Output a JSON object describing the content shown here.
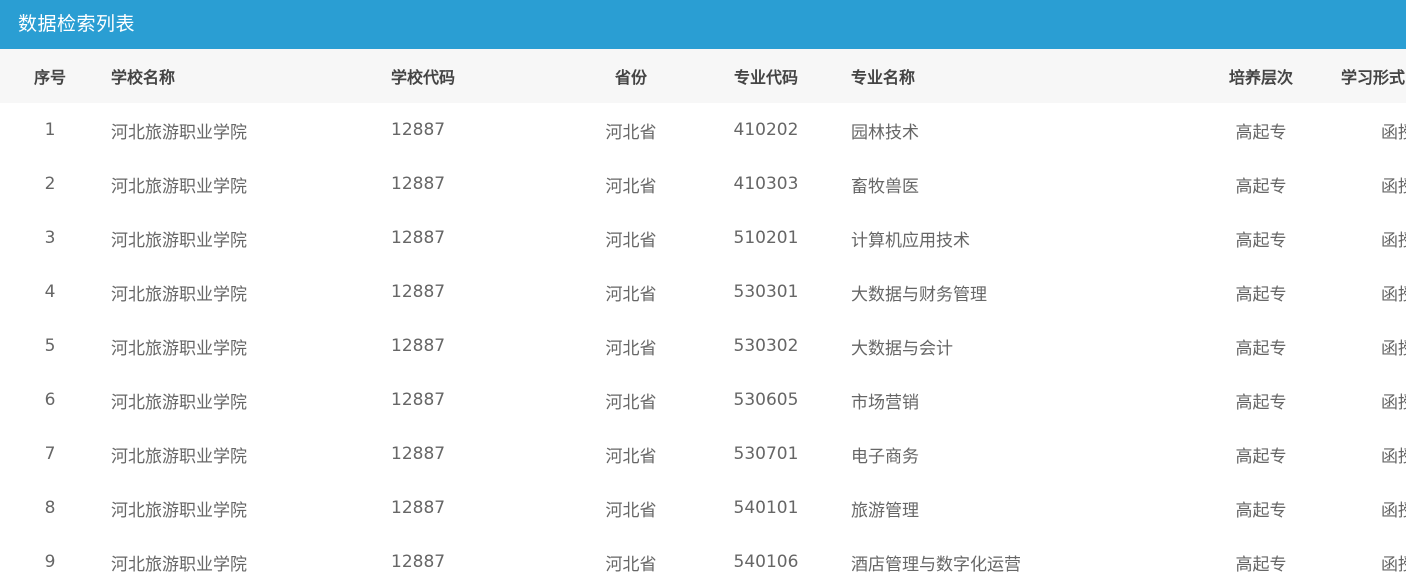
{
  "panel": {
    "title": "数据检索列表"
  },
  "columns": {
    "no": "序号",
    "school_name": "学校名称",
    "school_code": "学校代码",
    "province": "省份",
    "major_code": "专业代码",
    "major_name": "专业名称",
    "level": "培养层次",
    "mode": "学习形式"
  },
  "rows": [
    {
      "no": "1",
      "school_name": "河北旅游职业学院",
      "school_code": "12887",
      "province": "河北省",
      "major_code": "410202",
      "major_name": "园林技术",
      "level": "高起专",
      "mode": "函授"
    },
    {
      "no": "2",
      "school_name": "河北旅游职业学院",
      "school_code": "12887",
      "province": "河北省",
      "major_code": "410303",
      "major_name": "畜牧兽医",
      "level": "高起专",
      "mode": "函授"
    },
    {
      "no": "3",
      "school_name": "河北旅游职业学院",
      "school_code": "12887",
      "province": "河北省",
      "major_code": "510201",
      "major_name": "计算机应用技术",
      "level": "高起专",
      "mode": "函授"
    },
    {
      "no": "4",
      "school_name": "河北旅游职业学院",
      "school_code": "12887",
      "province": "河北省",
      "major_code": "530301",
      "major_name": "大数据与财务管理",
      "level": "高起专",
      "mode": "函授"
    },
    {
      "no": "5",
      "school_name": "河北旅游职业学院",
      "school_code": "12887",
      "province": "河北省",
      "major_code": "530302",
      "major_name": "大数据与会计",
      "level": "高起专",
      "mode": "函授"
    },
    {
      "no": "6",
      "school_name": "河北旅游职业学院",
      "school_code": "12887",
      "province": "河北省",
      "major_code": "530605",
      "major_name": "市场营销",
      "level": "高起专",
      "mode": "函授"
    },
    {
      "no": "7",
      "school_name": "河北旅游职业学院",
      "school_code": "12887",
      "province": "河北省",
      "major_code": "530701",
      "major_name": "电子商务",
      "level": "高起专",
      "mode": "函授"
    },
    {
      "no": "8",
      "school_name": "河北旅游职业学院",
      "school_code": "12887",
      "province": "河北省",
      "major_code": "540101",
      "major_name": "旅游管理",
      "level": "高起专",
      "mode": "函授"
    },
    {
      "no": "9",
      "school_name": "河北旅游职业学院",
      "school_code": "12887",
      "province": "河北省",
      "major_code": "540106",
      "major_name": "酒店管理与数字化运营",
      "level": "高起专",
      "mode": "函授"
    }
  ],
  "colors": {
    "header_bg": "#2a9ed3",
    "table_head_bg": "#f7f7f7"
  }
}
